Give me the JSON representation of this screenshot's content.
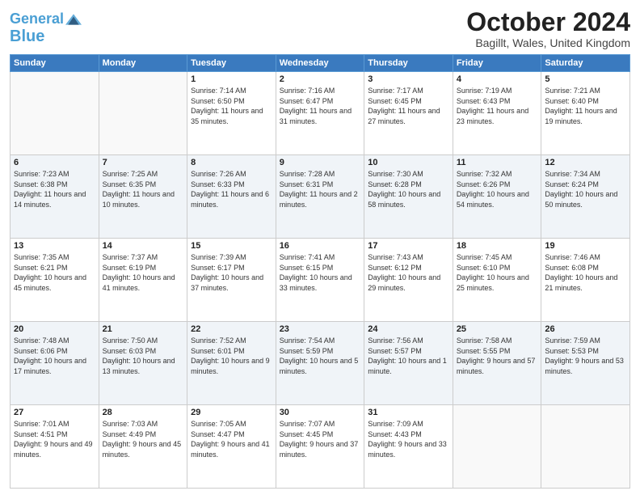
{
  "header": {
    "logo_line1": "General",
    "logo_line2": "Blue",
    "month_title": "October 2024",
    "location": "Bagillt, Wales, United Kingdom"
  },
  "days_of_week": [
    "Sunday",
    "Monday",
    "Tuesday",
    "Wednesday",
    "Thursday",
    "Friday",
    "Saturday"
  ],
  "weeks": [
    [
      {
        "day": "",
        "text": ""
      },
      {
        "day": "",
        "text": ""
      },
      {
        "day": "1",
        "text": "Sunrise: 7:14 AM\nSunset: 6:50 PM\nDaylight: 11 hours and 35 minutes."
      },
      {
        "day": "2",
        "text": "Sunrise: 7:16 AM\nSunset: 6:47 PM\nDaylight: 11 hours and 31 minutes."
      },
      {
        "day": "3",
        "text": "Sunrise: 7:17 AM\nSunset: 6:45 PM\nDaylight: 11 hours and 27 minutes."
      },
      {
        "day": "4",
        "text": "Sunrise: 7:19 AM\nSunset: 6:43 PM\nDaylight: 11 hours and 23 minutes."
      },
      {
        "day": "5",
        "text": "Sunrise: 7:21 AM\nSunset: 6:40 PM\nDaylight: 11 hours and 19 minutes."
      }
    ],
    [
      {
        "day": "6",
        "text": "Sunrise: 7:23 AM\nSunset: 6:38 PM\nDaylight: 11 hours and 14 minutes."
      },
      {
        "day": "7",
        "text": "Sunrise: 7:25 AM\nSunset: 6:35 PM\nDaylight: 11 hours and 10 minutes."
      },
      {
        "day": "8",
        "text": "Sunrise: 7:26 AM\nSunset: 6:33 PM\nDaylight: 11 hours and 6 minutes."
      },
      {
        "day": "9",
        "text": "Sunrise: 7:28 AM\nSunset: 6:31 PM\nDaylight: 11 hours and 2 minutes."
      },
      {
        "day": "10",
        "text": "Sunrise: 7:30 AM\nSunset: 6:28 PM\nDaylight: 10 hours and 58 minutes."
      },
      {
        "day": "11",
        "text": "Sunrise: 7:32 AM\nSunset: 6:26 PM\nDaylight: 10 hours and 54 minutes."
      },
      {
        "day": "12",
        "text": "Sunrise: 7:34 AM\nSunset: 6:24 PM\nDaylight: 10 hours and 50 minutes."
      }
    ],
    [
      {
        "day": "13",
        "text": "Sunrise: 7:35 AM\nSunset: 6:21 PM\nDaylight: 10 hours and 45 minutes."
      },
      {
        "day": "14",
        "text": "Sunrise: 7:37 AM\nSunset: 6:19 PM\nDaylight: 10 hours and 41 minutes."
      },
      {
        "day": "15",
        "text": "Sunrise: 7:39 AM\nSunset: 6:17 PM\nDaylight: 10 hours and 37 minutes."
      },
      {
        "day": "16",
        "text": "Sunrise: 7:41 AM\nSunset: 6:15 PM\nDaylight: 10 hours and 33 minutes."
      },
      {
        "day": "17",
        "text": "Sunrise: 7:43 AM\nSunset: 6:12 PM\nDaylight: 10 hours and 29 minutes."
      },
      {
        "day": "18",
        "text": "Sunrise: 7:45 AM\nSunset: 6:10 PM\nDaylight: 10 hours and 25 minutes."
      },
      {
        "day": "19",
        "text": "Sunrise: 7:46 AM\nSunset: 6:08 PM\nDaylight: 10 hours and 21 minutes."
      }
    ],
    [
      {
        "day": "20",
        "text": "Sunrise: 7:48 AM\nSunset: 6:06 PM\nDaylight: 10 hours and 17 minutes."
      },
      {
        "day": "21",
        "text": "Sunrise: 7:50 AM\nSunset: 6:03 PM\nDaylight: 10 hours and 13 minutes."
      },
      {
        "day": "22",
        "text": "Sunrise: 7:52 AM\nSunset: 6:01 PM\nDaylight: 10 hours and 9 minutes."
      },
      {
        "day": "23",
        "text": "Sunrise: 7:54 AM\nSunset: 5:59 PM\nDaylight: 10 hours and 5 minutes."
      },
      {
        "day": "24",
        "text": "Sunrise: 7:56 AM\nSunset: 5:57 PM\nDaylight: 10 hours and 1 minute."
      },
      {
        "day": "25",
        "text": "Sunrise: 7:58 AM\nSunset: 5:55 PM\nDaylight: 9 hours and 57 minutes."
      },
      {
        "day": "26",
        "text": "Sunrise: 7:59 AM\nSunset: 5:53 PM\nDaylight: 9 hours and 53 minutes."
      }
    ],
    [
      {
        "day": "27",
        "text": "Sunrise: 7:01 AM\nSunset: 4:51 PM\nDaylight: 9 hours and 49 minutes."
      },
      {
        "day": "28",
        "text": "Sunrise: 7:03 AM\nSunset: 4:49 PM\nDaylight: 9 hours and 45 minutes."
      },
      {
        "day": "29",
        "text": "Sunrise: 7:05 AM\nSunset: 4:47 PM\nDaylight: 9 hours and 41 minutes."
      },
      {
        "day": "30",
        "text": "Sunrise: 7:07 AM\nSunset: 4:45 PM\nDaylight: 9 hours and 37 minutes."
      },
      {
        "day": "31",
        "text": "Sunrise: 7:09 AM\nSunset: 4:43 PM\nDaylight: 9 hours and 33 minutes."
      },
      {
        "day": "",
        "text": ""
      },
      {
        "day": "",
        "text": ""
      }
    ]
  ]
}
